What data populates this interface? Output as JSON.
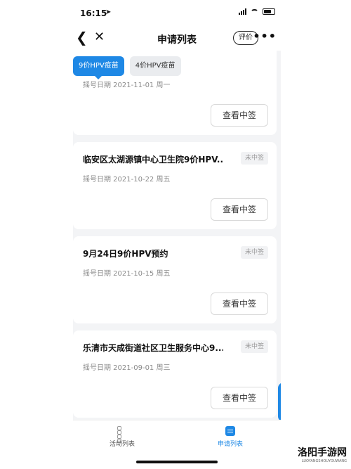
{
  "status": {
    "time": "16:15",
    "location_glyph": "➤"
  },
  "nav": {
    "back_glyph": "❮",
    "close_glyph": "✕",
    "title": "申请列表",
    "rate_label": "评价",
    "more_glyph": "•••"
  },
  "tabs": [
    {
      "label": "9价HPV疫苗",
      "active": true
    },
    {
      "label": "4价HPV疫苗",
      "active": false
    }
  ],
  "cards": [
    {
      "title": "",
      "badge": "",
      "date": "摇号日期 2021-11-01 周一",
      "button": "查看中签"
    },
    {
      "title": "临安区太湖源镇中心卫生院9价HPV...",
      "badge": "未中签",
      "date": "摇号日期 2021-10-22 周五",
      "button": "查看中签"
    },
    {
      "title": "9月24日9价HPV预约",
      "badge": "未中签",
      "date": "摇号日期 2021-10-15 周五",
      "button": "查看中签"
    },
    {
      "title": "乐清市天成街道社区卫生服务中心9...",
      "badge": "未中签",
      "date": "摇号日期 2021-09-01 周三",
      "button": "查看中签"
    }
  ],
  "tab_bar": {
    "items": [
      {
        "label": "活动列表",
        "icon": "grid-icon",
        "active": false
      },
      {
        "label": "申请列表",
        "icon": "document-icon",
        "active": true
      }
    ]
  },
  "watermark": {
    "text": "洛阳手游网",
    "sub": "LUOYANGSHOUYOUWANG"
  },
  "colors": {
    "accent": "#1e88e5",
    "background": "#f3f4f6",
    "badge_text": "#9a9a9a"
  }
}
